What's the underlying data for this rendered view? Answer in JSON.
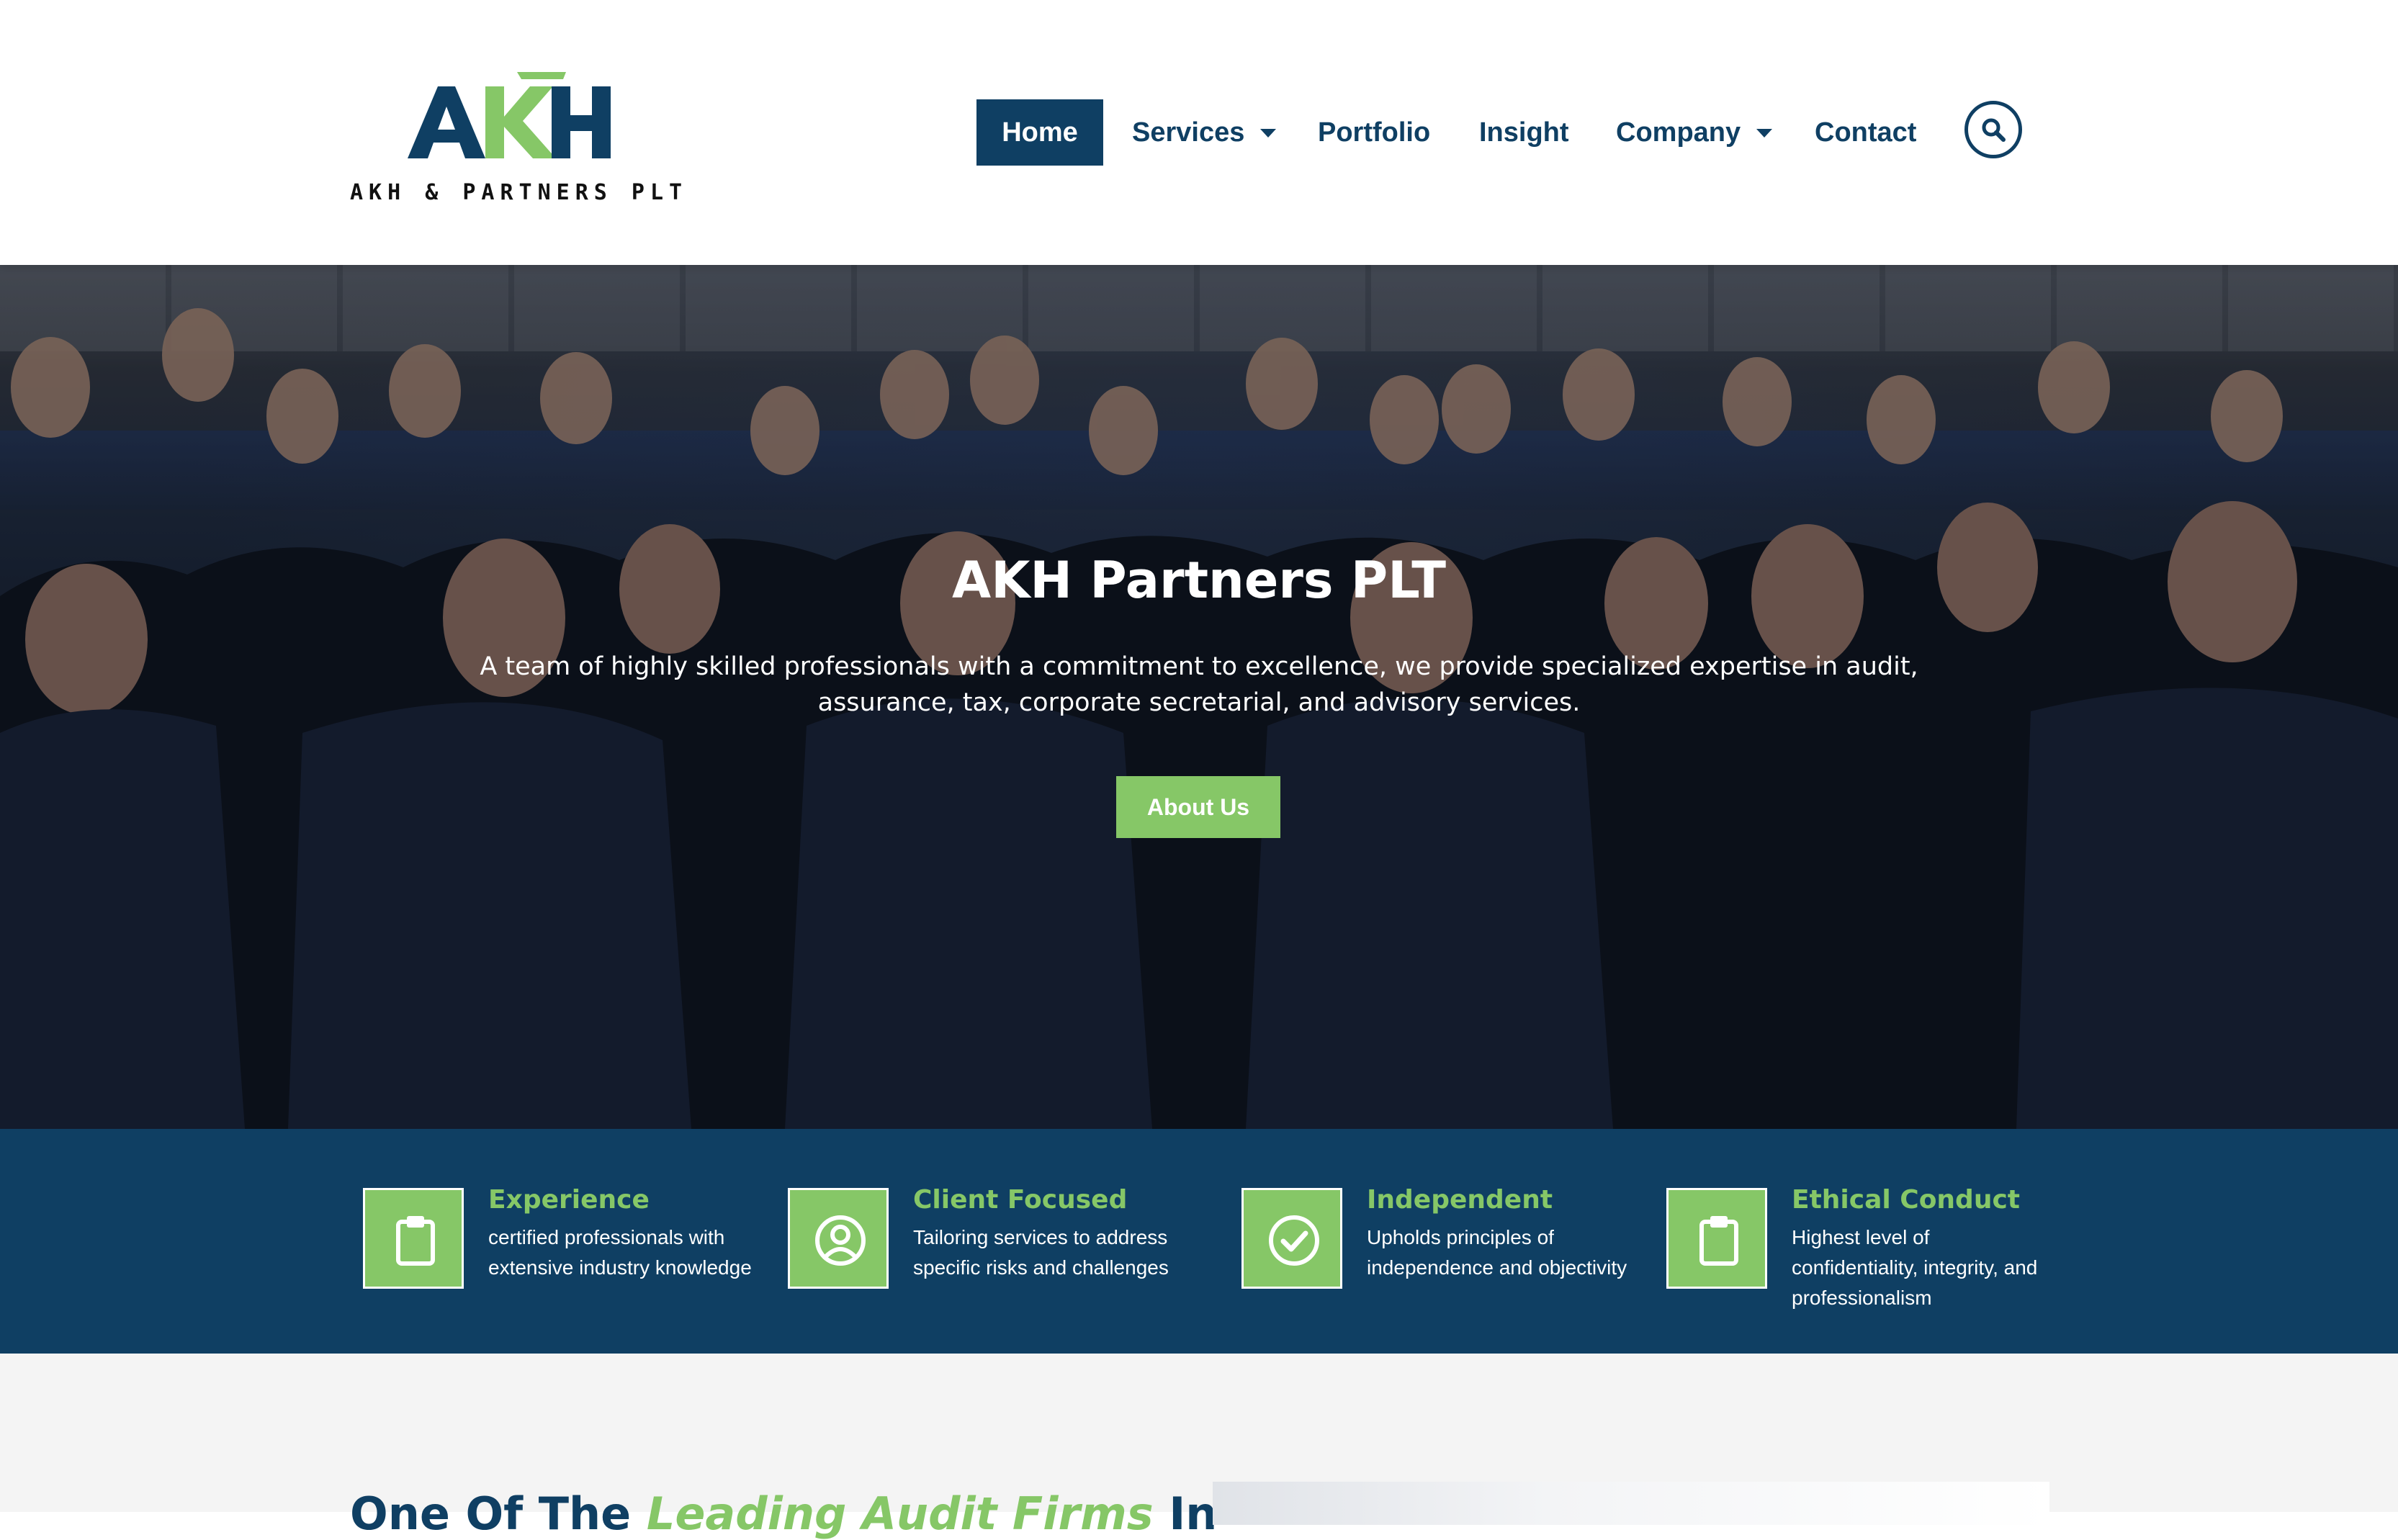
{
  "brand": {
    "logo_letters": "AKH",
    "logo_sub": "AKH & PARTNERS PLT",
    "colors": {
      "navy": "#0f3f63",
      "green": "#86c767"
    }
  },
  "nav": {
    "items": [
      {
        "label": "Home",
        "active": true
      },
      {
        "label": "Services",
        "dropdown": true
      },
      {
        "label": "Portfolio"
      },
      {
        "label": "Insight"
      },
      {
        "label": "Company",
        "dropdown": true
      },
      {
        "label": "Contact"
      }
    ],
    "search_icon": "search-icon"
  },
  "hero": {
    "title": "AKH Partners PLT",
    "text": "A team of highly skilled professionals with a commitment to excellence, we provide specialized expertise in audit, assurance, tax, corporate secretarial, and advisory services.",
    "button": "About Us"
  },
  "features": [
    {
      "icon": "clipboard-icon",
      "title": "Experience",
      "desc": "certified professionals with extensive industry knowledge"
    },
    {
      "icon": "user-circle-icon",
      "title": "Client Focused",
      "desc": "Tailoring services to address specific risks and challenges"
    },
    {
      "icon": "check-circle-icon",
      "title": "Independent",
      "desc": "Upholds principles of independence and objectivity"
    },
    {
      "icon": "clipboard-icon",
      "title": "Ethical Conduct",
      "desc": "Highest level of confidentiality, integrity, and professionalism"
    }
  ],
  "lower": {
    "heading_start": "One Of The ",
    "heading_highlight": "Leading Audit Firms",
    "heading_end": " In"
  }
}
